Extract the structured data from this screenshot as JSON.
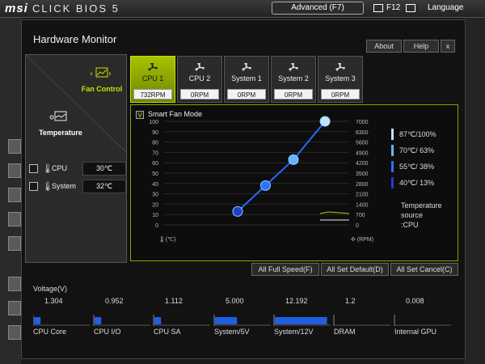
{
  "header": {
    "brand": "msi",
    "product": "CLICK BIOS 5",
    "advanced_label": "Advanced (F7)",
    "f12_label": "F12",
    "language_label": "Language"
  },
  "dialog": {
    "title": "Hardware Monitor",
    "about_label": "About",
    "help_label": "Help",
    "close_label": "x"
  },
  "left_panel": {
    "fan_control_label": "Fan Control",
    "temperature_label": "Temperature",
    "temps": [
      {
        "label": "CPU",
        "value": "30℃"
      },
      {
        "label": "System",
        "value": "32℃"
      }
    ]
  },
  "fans": [
    {
      "name": "CPU 1",
      "rpm": "732RPM",
      "active": true
    },
    {
      "name": "CPU 2",
      "rpm": "0RPM",
      "active": false
    },
    {
      "name": "System 1",
      "rpm": "0RPM",
      "active": false
    },
    {
      "name": "System 2",
      "rpm": "0RPM",
      "active": false
    },
    {
      "name": "System 3",
      "rpm": "0RPM",
      "active": false
    }
  ],
  "graph": {
    "smart_fan_label": "Smart Fan Mode",
    "smart_fan_checked": "V",
    "left_unit": "(℃)",
    "right_unit": "(RPM)",
    "left_ticks": [
      "100",
      "90",
      "80",
      "70",
      "60",
      "50",
      "40",
      "30",
      "20",
      "10",
      "0"
    ],
    "right_ticks": [
      "7000",
      "6300",
      "5600",
      "4900",
      "4200",
      "3500",
      "2800",
      "2100",
      "1400",
      "700",
      "0"
    ],
    "points": [
      {
        "temp": 40,
        "percent": 13
      },
      {
        "temp": 55,
        "percent": 38
      },
      {
        "temp": 70,
        "percent": 63
      },
      {
        "temp": 87,
        "percent": 100
      }
    ],
    "legend": [
      {
        "text": "87℃/100%",
        "color": "#bfe3ff"
      },
      {
        "text": "70℃/ 63%",
        "color": "#63b3ff"
      },
      {
        "text": "55℃/ 38%",
        "color": "#2a72ff"
      },
      {
        "text": "40℃/ 13%",
        "color": "#1c3fc9"
      }
    ],
    "temperature_source_label": "Temperature source",
    "temperature_source_value": ":CPU"
  },
  "actions": {
    "full_speed": "All Full Speed(F)",
    "set_default": "All Set Default(D)",
    "set_cancel": "All Set Cancel(C)"
  },
  "voltage": {
    "title": "Voltage(V)",
    "items": [
      {
        "name": "CPU Core",
        "value": "1.304",
        "fill": 0.12
      },
      {
        "name": "CPU I/O",
        "value": "0.952",
        "fill": 0.12
      },
      {
        "name": "CPU SA",
        "value": "1.112",
        "fill": 0.12
      },
      {
        "name": "System/5V",
        "value": "5.000",
        "fill": 0.4
      },
      {
        "name": "System/12V",
        "value": "12.192",
        "fill": 0.95
      },
      {
        "name": "DRAM",
        "value": "1.2",
        "fill": 0.0
      },
      {
        "name": "Internal GPU",
        "value": "0.008",
        "fill": 0.0
      }
    ]
  }
}
